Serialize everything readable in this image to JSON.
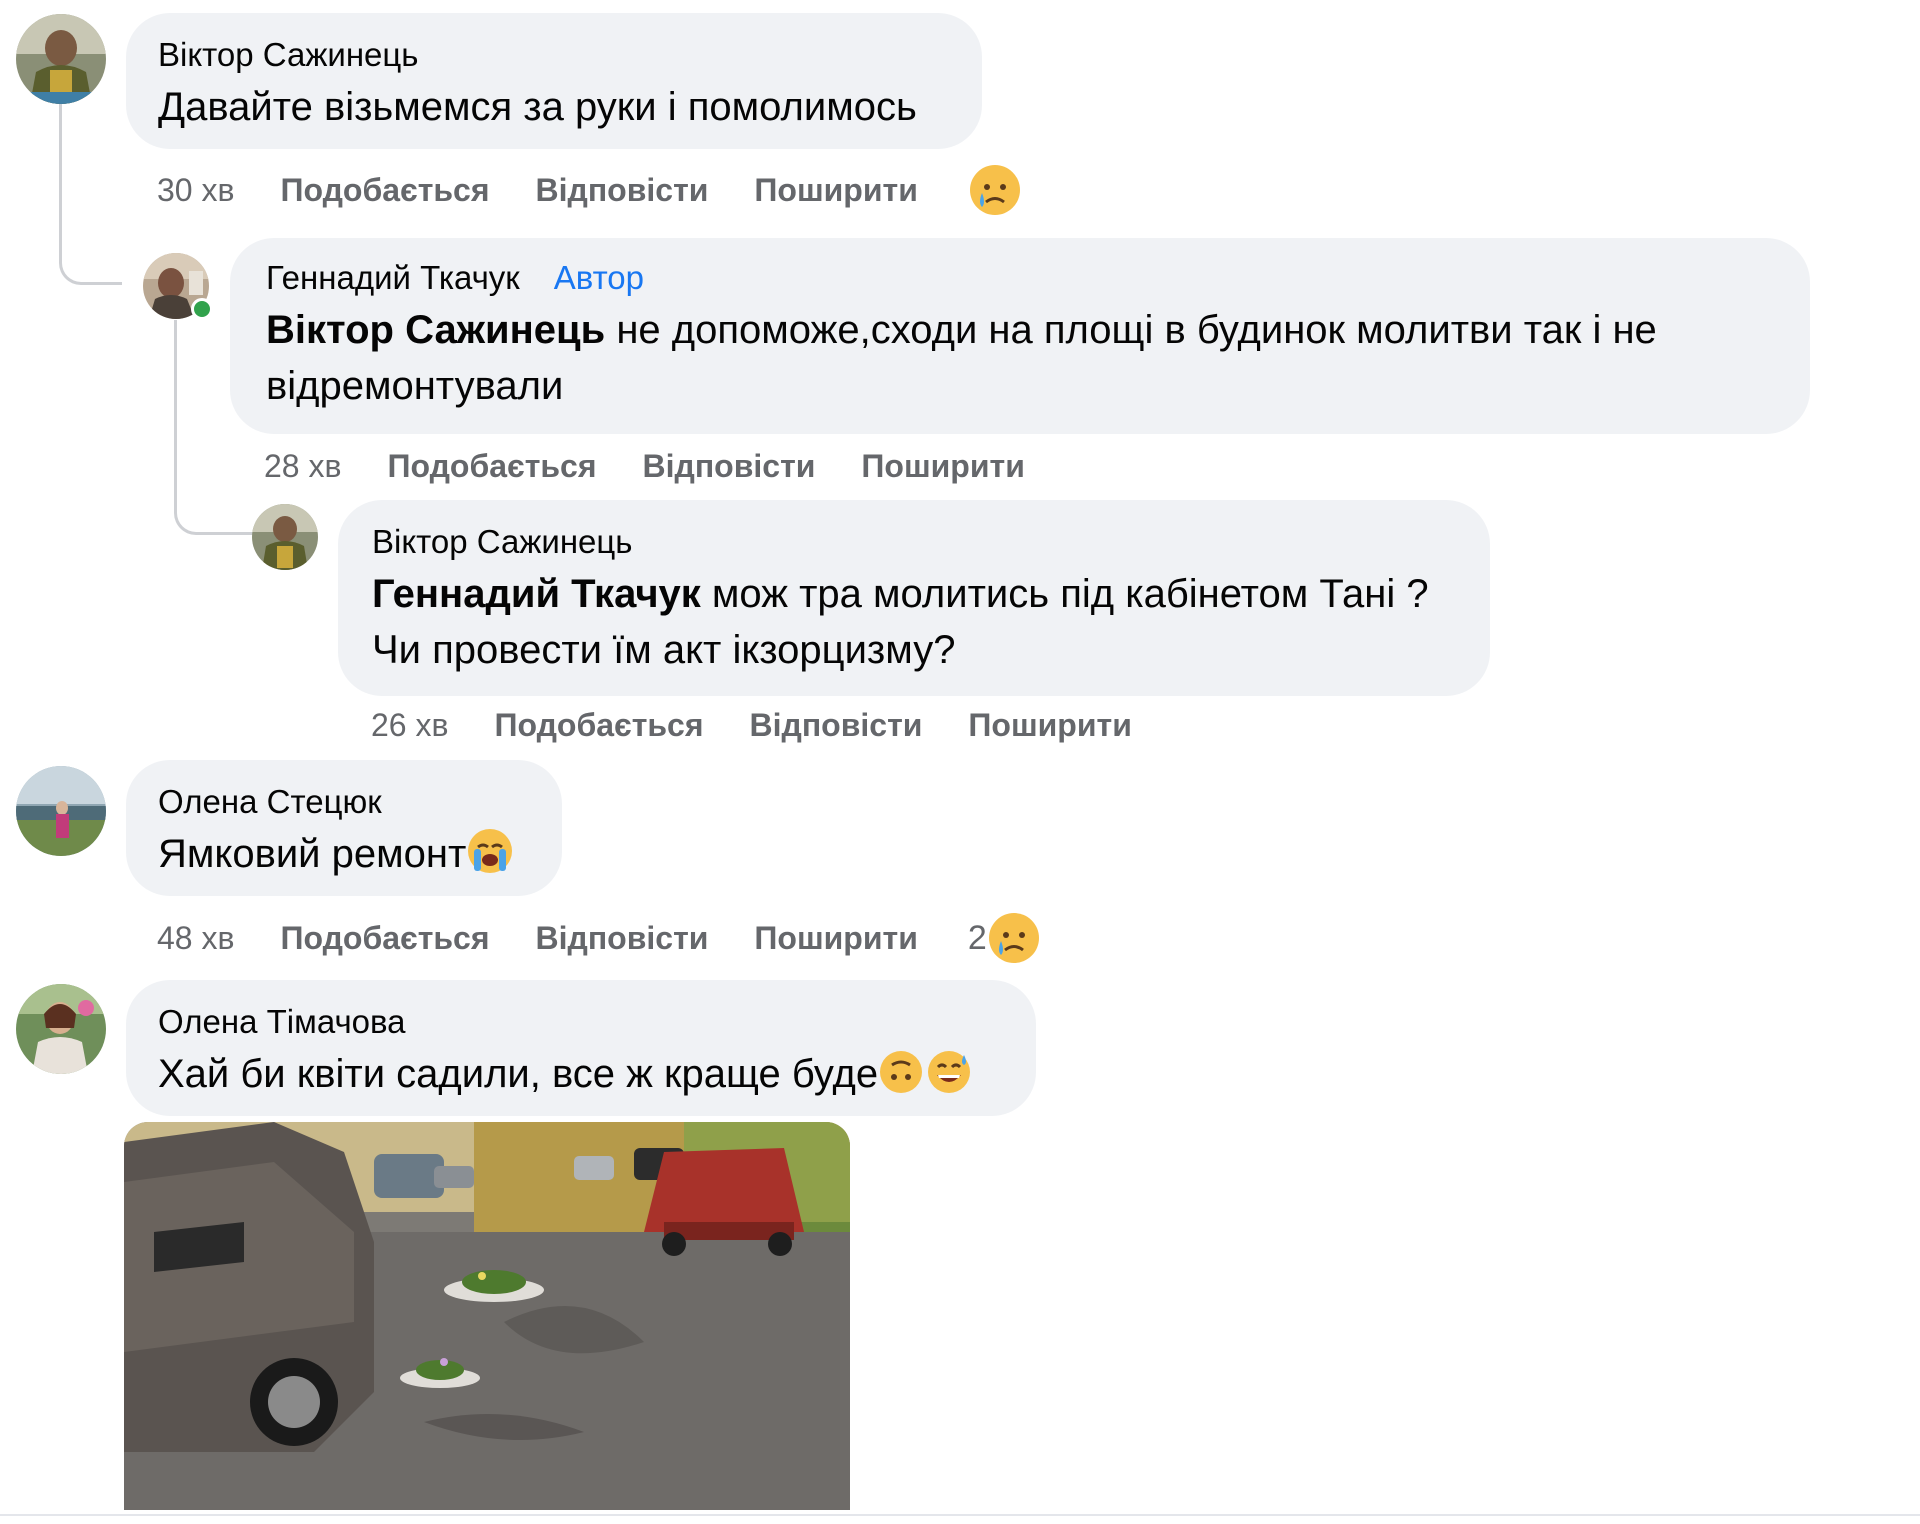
{
  "actions": {
    "like": "Подобається",
    "reply": "Відповісти",
    "share": "Поширити"
  },
  "comments": [
    {
      "author": "Віктор Сажинець",
      "text": "Давайте візьмемся за руки і помолимось",
      "time": "30 хв",
      "reaction": "crying-face"
    },
    {
      "author": "Геннадий Ткачук",
      "badge": "Автор",
      "mention": "Віктор Сажинець",
      "text": " не допоможе,сходи на площі в будинок молитви так і не відремонтували",
      "time": "28 хв"
    },
    {
      "author": "Віктор Сажинець",
      "mention": "Геннадий Ткачук",
      "text": " мож тра молитись під кабінетом Тані ? Чи провести їм акт ікзорцизму?",
      "time": "26 хв"
    },
    {
      "author": "Олена Стецюк",
      "text": "Ямковий ремонт",
      "text_emoji": "loudly-crying-face",
      "time": "48 хв",
      "reaction_count": "2",
      "reaction": "crying-face"
    },
    {
      "author": "Олена Тімачова",
      "text": "Хай би квіти садили, все ж краще буде",
      "text_emoji": [
        "upside-down-face",
        "grinning-sweat-face"
      ],
      "attachment": "photo of street with flowers planted in potholes"
    }
  ],
  "colors": {
    "bubble": "#f0f2f5",
    "meta": "#65676b",
    "author_badge": "#1877f2",
    "online": "#31a24c"
  }
}
